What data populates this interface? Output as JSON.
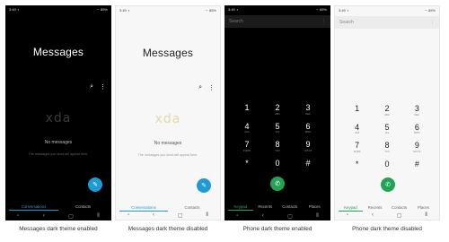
{
  "status": {
    "time": "3:49",
    "battery": "85%"
  },
  "messages": {
    "title": "Messages",
    "watermark": "xda",
    "empty_title": "No messages",
    "empty_sub": "The messages you send will appear here.",
    "tabs": [
      "Conversations",
      "Contacts"
    ],
    "search_icon": "search-icon",
    "more_icon": "more-icon"
  },
  "phone": {
    "search_placeholder": "Search",
    "tabs": [
      "Keypad",
      "Recents",
      "Contacts",
      "Places"
    ],
    "keys": [
      {
        "digit": "1",
        "letters": ""
      },
      {
        "digit": "2",
        "letters": "ABC"
      },
      {
        "digit": "3",
        "letters": "DEF"
      },
      {
        "digit": "4",
        "letters": "GHI"
      },
      {
        "digit": "5",
        "letters": "JKL"
      },
      {
        "digit": "6",
        "letters": "MNO"
      },
      {
        "digit": "7",
        "letters": "PQRS"
      },
      {
        "digit": "8",
        "letters": "TUV"
      },
      {
        "digit": "9",
        "letters": "WXYZ"
      },
      {
        "digit": "*",
        "letters": ""
      },
      {
        "digit": "0",
        "letters": "+"
      },
      {
        "digit": "#",
        "letters": ""
      }
    ]
  },
  "captions": [
    "Messages dark theme enabled",
    "Messages dark theme disabled",
    "Phone dark theme enabled",
    "Phone dark theme disabled"
  ],
  "colors": {
    "messages_accent": "#1e9ad6",
    "phone_accent": "#23a455"
  }
}
